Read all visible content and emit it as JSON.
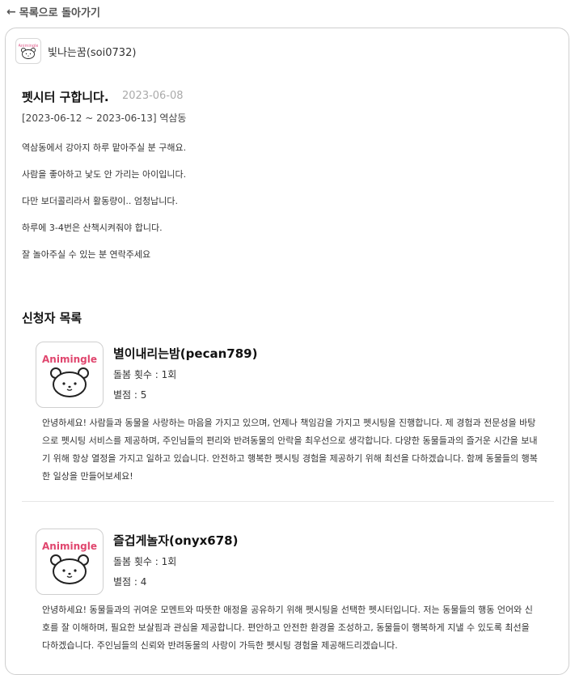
{
  "nav": {
    "back_arrow": "←",
    "back_label": "목록으로 돌아가기"
  },
  "author": {
    "name": "빛나는꿈(soi0732)"
  },
  "post": {
    "title": "펫시터 구합니다.",
    "date": "2023-06-08",
    "period": "[2023-06-12 ~ 2023-06-13] 역삼동",
    "body": [
      "역삼동에서 강아지 하루 맡아주실 분 구해요.",
      "사람을 좋아하고 낯도 안 가리는 아이입니다.",
      "다만 보더콜리라서 활동량이.. 엄청납니다.",
      "하루에 3-4번은 산책시켜줘야 합니다.",
      "잘 놀아주실 수 있는 분 연락주세요"
    ]
  },
  "applicants_section": {
    "title": "신청자 목록",
    "logo_text": "Animingle",
    "applicants": [
      {
        "name": "별이내리는밤(pecan789)",
        "care_count": "돌봄 횟수 : 1회",
        "rating": "별점 : 5",
        "intro": "안녕하세요! 사람들과 동물을 사랑하는 마음을 가지고 있으며, 언제나 책임감을 가지고 펫시팅을 진행합니다. 제 경험과 전문성을 바탕으로 펫시팅 서비스를 제공하며, 주인님들의 편리와 반려동물의 안락을 최우선으로 생각합니다. 다양한 동물들과의 즐거운 시간을 보내기 위해 항상 열정을 가지고 일하고 있습니다. 안전하고 행복한 펫시팅 경험을 제공하기 위해 최선을 다하겠습니다. 함께 동물들의 행복한 일상을 만들어보세요!"
      },
      {
        "name": "즐겁게놀자(onyx678)",
        "care_count": "돌봄 횟수 : 1회",
        "rating": "별점 : 4",
        "intro": "안녕하세요! 동물들과의 귀여운 모멘트와 따뜻한 애정을 공유하기 위해 펫시팅을 선택한 펫시터입니다. 저는 동물들의 행동 언어와 신호를 잘 이해하며, 필요한 보살핌과 관심을 제공합니다. 편안하고 안전한 환경을 조성하고, 동물들이 행복하게 지낼 수 있도록 최선을 다하겠습니다. 주인님들의 신뢰와 반려동물의 사랑이 가득한 펫시팅 경험을 제공해드리겠습니다."
      }
    ]
  }
}
